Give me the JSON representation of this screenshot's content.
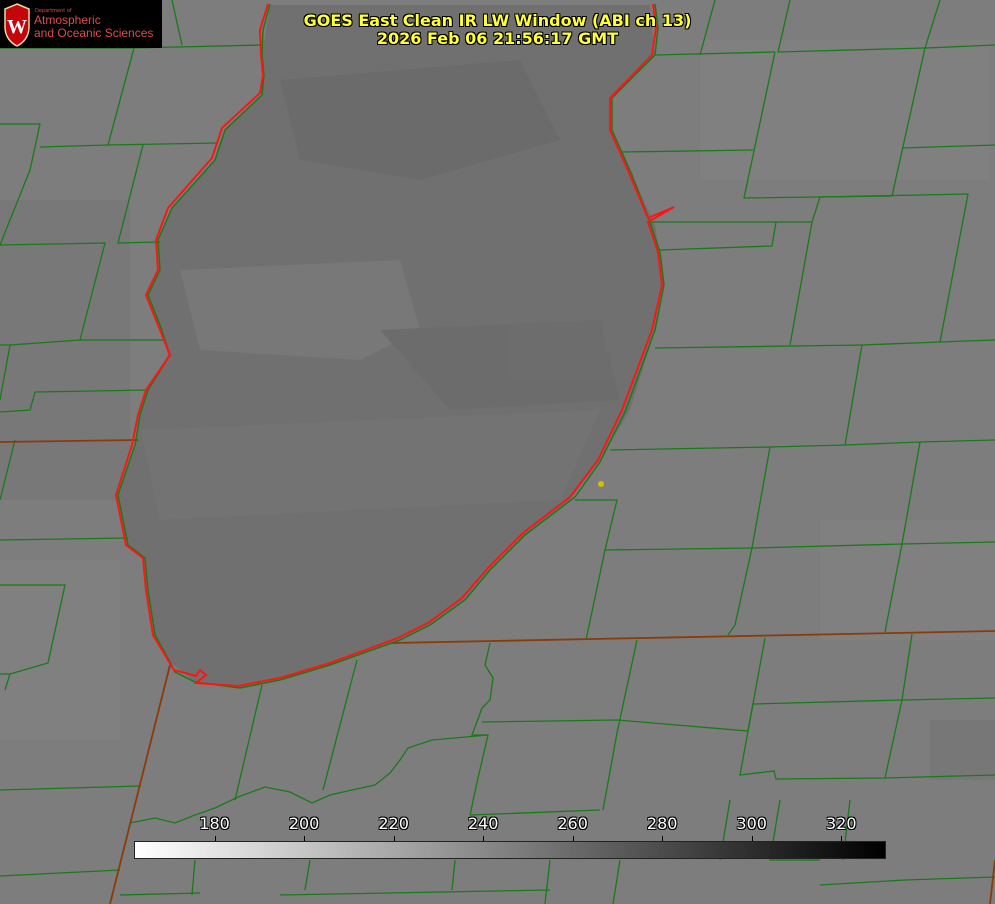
{
  "header": {
    "title_line1": "GOES East Clean IR LW Window (ABI ch 13)",
    "title_line2": "2026 Feb 06 21:56:17 GMT"
  },
  "logo": {
    "dept_text": "Department of",
    "line1": "Atmospheric",
    "line2": "and Oceanic Sciences",
    "emblem_letter": "W"
  },
  "colorbar": {
    "ticks": [
      "180",
      "200",
      "220",
      "240",
      "260",
      "280",
      "300",
      "320"
    ],
    "vmin": 162,
    "vmax": 330,
    "gradient_start": "#ffffff",
    "gradient_end": "#000000"
  },
  "map": {
    "background_color": "#7c7c7c",
    "lake_color": "#6d6d6d",
    "county_line_color": "#1a7a1a",
    "state_line_color": "#8b3a0a",
    "coastline_color": "#ff1a1a",
    "marker_color": "#d4c000"
  }
}
